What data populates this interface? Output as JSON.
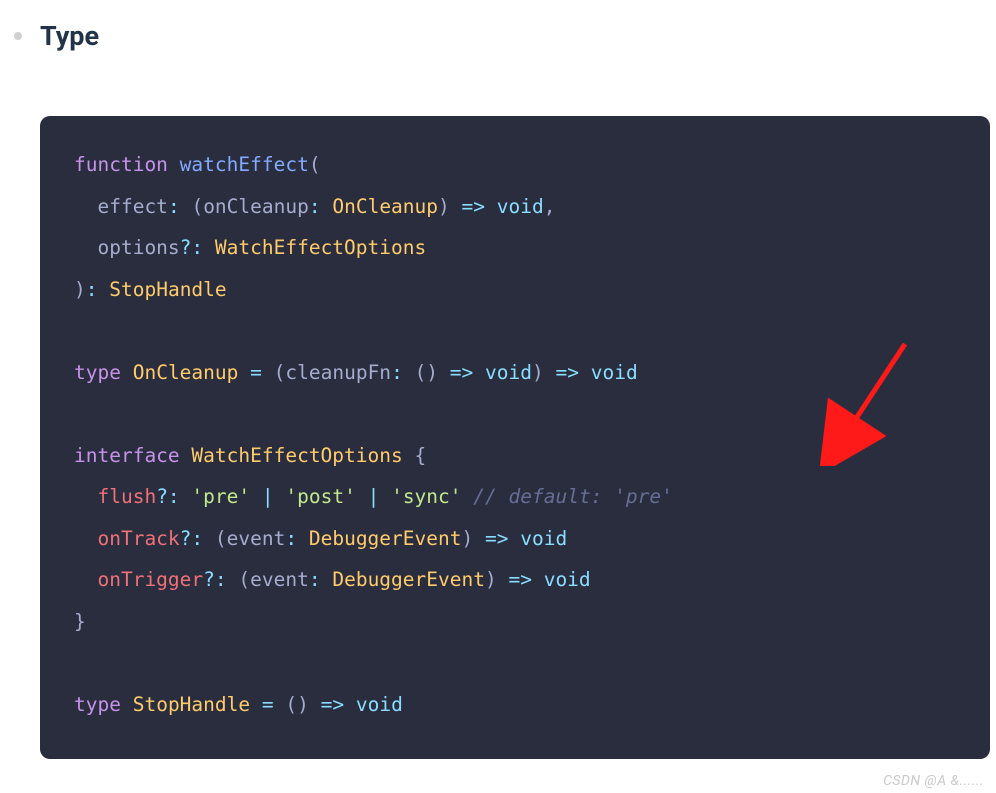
{
  "heading": "Type",
  "code": {
    "l1_kw": "function",
    "l1_fn": "watchEffect",
    "l2_param": "effect",
    "l2_onCleanupParam": "onCleanup",
    "l2_onCleanupType": "OnCleanup",
    "l2_void": "void",
    "l3_param": "options",
    "l3_type": "WatchEffectOptions",
    "l4_ret": "StopHandle",
    "l6_kw": "type",
    "l6_name": "OnCleanup",
    "l6_param": "cleanupFn",
    "l6_void": "void",
    "l8_kw": "interface",
    "l8_name": "WatchEffectOptions",
    "l9_prop": "flush",
    "l9_s1": "'pre'",
    "l9_s2": "'post'",
    "l9_s3": "'sync'",
    "l9_comment": "// default: 'pre'",
    "l10_prop": "onTrack",
    "l10_param": "event",
    "l10_type": "DebuggerEvent",
    "l10_void": "void",
    "l11_prop": "onTrigger",
    "l11_param": "event",
    "l11_type": "DebuggerEvent",
    "l11_void": "void",
    "l14_kw": "type",
    "l14_name": "StopHandle",
    "l14_void": "void"
  },
  "watermark": "CSDN @A &......"
}
